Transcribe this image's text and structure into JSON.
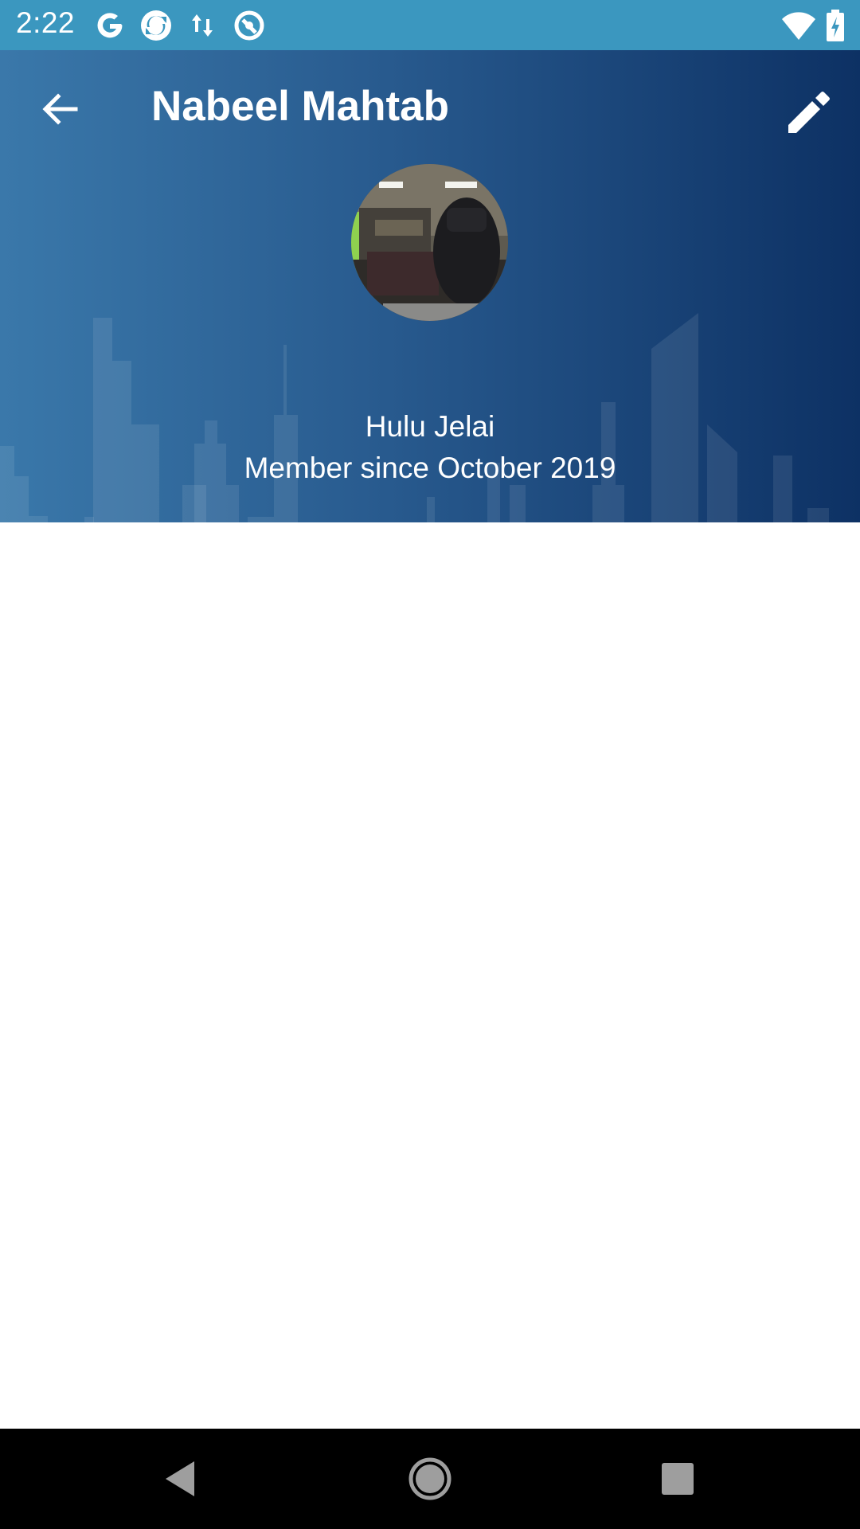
{
  "status_bar": {
    "time": "2:22",
    "icons": [
      "google-icon",
      "sync-app-icon",
      "data-transfer-icon",
      "app-icon",
      "wifi-icon",
      "battery-charging-icon"
    ]
  },
  "app_bar": {
    "title": "Nabeel Mahtab",
    "back_icon": "arrow-back-icon",
    "edit_icon": "pencil-edit-icon"
  },
  "profile": {
    "location": "Hulu Jelai",
    "member_since": "Member since October 2019"
  },
  "nav_bar": {
    "icons": [
      "back-triangle-icon",
      "home-circle-icon",
      "recents-square-icon"
    ]
  },
  "colors": {
    "status_bar": "#3b97bf",
    "header_start": "#3a78aa",
    "header_end": "#0d3164"
  }
}
